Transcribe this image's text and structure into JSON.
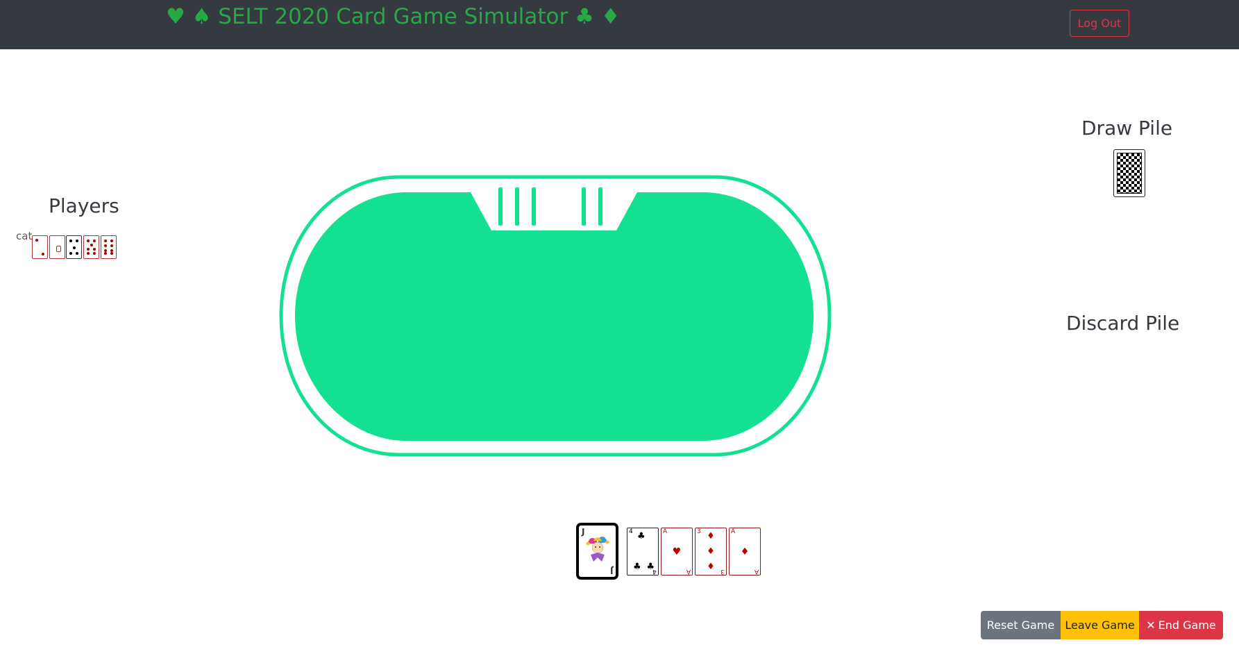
{
  "navbar": {
    "title": "♥ ♠ SELT 2020 Card Game Simulator ♣ ♦",
    "logout_label": "Log Out",
    "brand_color": "#28a745",
    "background": "#343a40"
  },
  "players_panel": {
    "heading": "Players",
    "players": [
      {
        "name": "cat"
      }
    ]
  },
  "draw_pile": {
    "heading": "Draw Pile"
  },
  "discard_pile": {
    "heading": "Discard Pile"
  },
  "table": {
    "felt_color": "#14e092"
  },
  "hand": {
    "joker": {
      "rank": "J"
    },
    "cards": [
      {
        "rank": "4",
        "suit": "♣",
        "color": "black"
      },
      {
        "rank": "A",
        "suit": "♥",
        "color": "red"
      },
      {
        "rank": "3",
        "suit": "♦",
        "color": "red"
      },
      {
        "rank": "A",
        "suit": "♦",
        "color": "red"
      }
    ]
  },
  "controls": {
    "reset_label": "Reset Game",
    "leave_label": "Leave Game",
    "end_label": "End Game",
    "end_icon": "✕"
  }
}
